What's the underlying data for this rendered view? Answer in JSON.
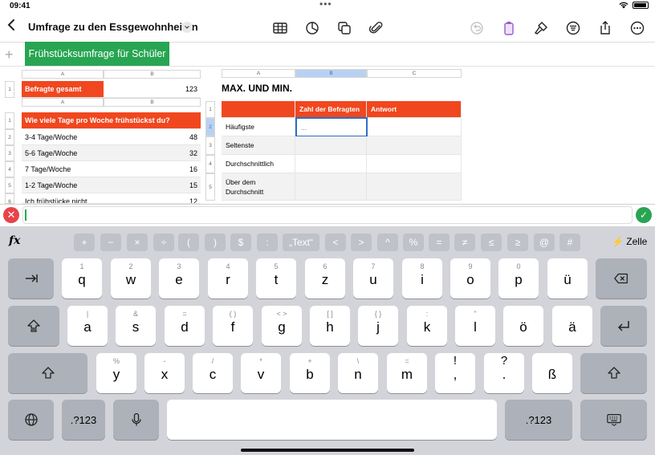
{
  "status": {
    "time": "09:41"
  },
  "toolbar": {
    "title": "Umfrage zu den Essgewohnheiten"
  },
  "sheet": {
    "active_tab": "Frühstücksumfrage für Schüler"
  },
  "table1": {
    "col_a": "A",
    "col_b": "B",
    "row1": "1",
    "label": "Befragte gesamt",
    "value": "123"
  },
  "table2": {
    "col_a": "A",
    "col_b": "B",
    "header": "Wie viele Tage pro Woche frühstückst du?",
    "rows": [
      {
        "num": "1"
      },
      {
        "num": "2",
        "label": "3-4 Tage/Woche",
        "value": "48"
      },
      {
        "num": "3",
        "label": "5-6 Tage/Woche",
        "value": "32"
      },
      {
        "num": "4",
        "label": "7 Tage/Woche",
        "value": "16"
      },
      {
        "num": "5",
        "label": "1-2 Tage/Woche",
        "value": "15"
      },
      {
        "num": "6",
        "label": "Ich frühstücke nicht",
        "value": "12"
      }
    ]
  },
  "table3": {
    "title": "MAX. UND MIN.",
    "col_a": "A",
    "col_b": "B",
    "col_c": "C",
    "header_b": "Zahl der Befragten",
    "header_c": "Antwort",
    "rows": [
      {
        "num": "1"
      },
      {
        "num": "2",
        "label": "Häufigste",
        "value": "..."
      },
      {
        "num": "3",
        "label": "Seltenste"
      },
      {
        "num": "4",
        "label": "Durchschnittlich"
      },
      {
        "num": "5",
        "label": "Über dem Durchschnitt"
      }
    ]
  },
  "formula_ops": [
    "+",
    "−",
    "×",
    "÷",
    "(",
    ")",
    "$",
    ":",
    "„Text“",
    "<",
    ">",
    "^",
    "%",
    "=",
    "≠",
    "≤",
    "≥",
    "@",
    "#"
  ],
  "formula_mode": "Zelle",
  "keyboard": {
    "row1": [
      {
        "sec": "1",
        "pri": "q"
      },
      {
        "sec": "2",
        "pri": "w"
      },
      {
        "sec": "3",
        "pri": "e"
      },
      {
        "sec": "4",
        "pri": "r"
      },
      {
        "sec": "5",
        "pri": "t"
      },
      {
        "sec": "6",
        "pri": "z"
      },
      {
        "sec": "7",
        "pri": "u"
      },
      {
        "sec": "8",
        "pri": "i"
      },
      {
        "sec": "9",
        "pri": "o"
      },
      {
        "sec": "0",
        "pri": "p"
      },
      {
        "sec": "",
        "pri": "ü"
      }
    ],
    "row2": [
      {
        "sec": "|",
        "pri": "a"
      },
      {
        "sec": "&",
        "pri": "s"
      },
      {
        "sec": "=",
        "pri": "d"
      },
      {
        "sec": "( )",
        "pri": "f"
      },
      {
        "sec": "< >",
        "pri": "g"
      },
      {
        "sec": "[ ]",
        "pri": "h"
      },
      {
        "sec": "{ }",
        "pri": "j"
      },
      {
        "sec": ":",
        "pri": "k"
      },
      {
        "sec": "\"",
        "pri": "l"
      },
      {
        "sec": "",
        "pri": "ö"
      },
      {
        "sec": "",
        "pri": "ä"
      }
    ],
    "row3": [
      {
        "sec": "%",
        "pri": "y"
      },
      {
        "sec": "-",
        "pri": "x"
      },
      {
        "sec": "/",
        "pri": "c"
      },
      {
        "sec": "*",
        "pri": "v"
      },
      {
        "sec": "+",
        "pri": "b"
      },
      {
        "sec": "\\",
        "pri": "n"
      },
      {
        "sec": "=",
        "pri": "m"
      },
      {
        "sec": "!",
        "pri": ","
      },
      {
        "sec": "?",
        "pri": "."
      },
      {
        "sec": "",
        "pri": "ß"
      }
    ],
    "numbers_label": ".?123"
  }
}
